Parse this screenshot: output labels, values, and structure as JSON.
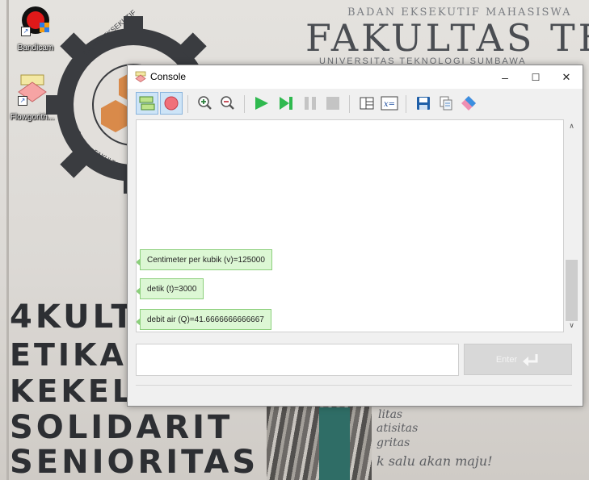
{
  "desktop": {
    "icons": [
      {
        "label": "Bandicam",
        "icon": "bandicam-icon"
      },
      {
        "label": "Flowgorith...",
        "icon": "flowgorithm-icon"
      }
    ],
    "wallpaper": {
      "line1": "BADAN  EKSEKUTIF MAHASISWA",
      "line2": "FAKULTAS TEKNIK",
      "line3": "UNIVERSITAS TEKNOLOGI SUMBAWA",
      "seal_top": "BADAN EKSEKUTIF MA",
      "seal_bottom": "FAKULTAS T",
      "words": [
        "4KULT",
        "ETIKA",
        "KEKEL",
        "SOLIDARIT",
        "SENIORITAS"
      ],
      "script": [
        "litas",
        "atisitas",
        "gritas",
        "k salu akan maju!"
      ]
    }
  },
  "window": {
    "title": "Console",
    "icon": "flowgorithm-console-icon",
    "controls": {
      "minimize": "–",
      "maximize": "☐",
      "close": "✕"
    },
    "toolbar": [
      {
        "name": "flowchart-view-icon",
        "active": true
      },
      {
        "name": "breakpoint-icon",
        "active": true
      },
      {
        "name": "zoom-in-icon"
      },
      {
        "name": "zoom-out-icon"
      },
      {
        "name": "run-icon"
      },
      {
        "name": "step-icon"
      },
      {
        "name": "pause-icon"
      },
      {
        "name": "stop-icon"
      },
      {
        "name": "layout-icon"
      },
      {
        "name": "variables-icon"
      },
      {
        "name": "save-icon"
      },
      {
        "name": "copy-icon"
      },
      {
        "name": "clear-icon"
      }
    ],
    "messages": [
      "Centimeter per kubik (v)=125000",
      "detik (t)=3000",
      "debit air (Q)=41.6666666666667"
    ],
    "input": {
      "value": "",
      "placeholder": ""
    },
    "enter_label": "Enter",
    "colors": {
      "message_bg": "#dcf7d4",
      "message_border": "#8ccf7c",
      "run": "#2fb94f",
      "zoom": "#2a7e3b"
    }
  }
}
